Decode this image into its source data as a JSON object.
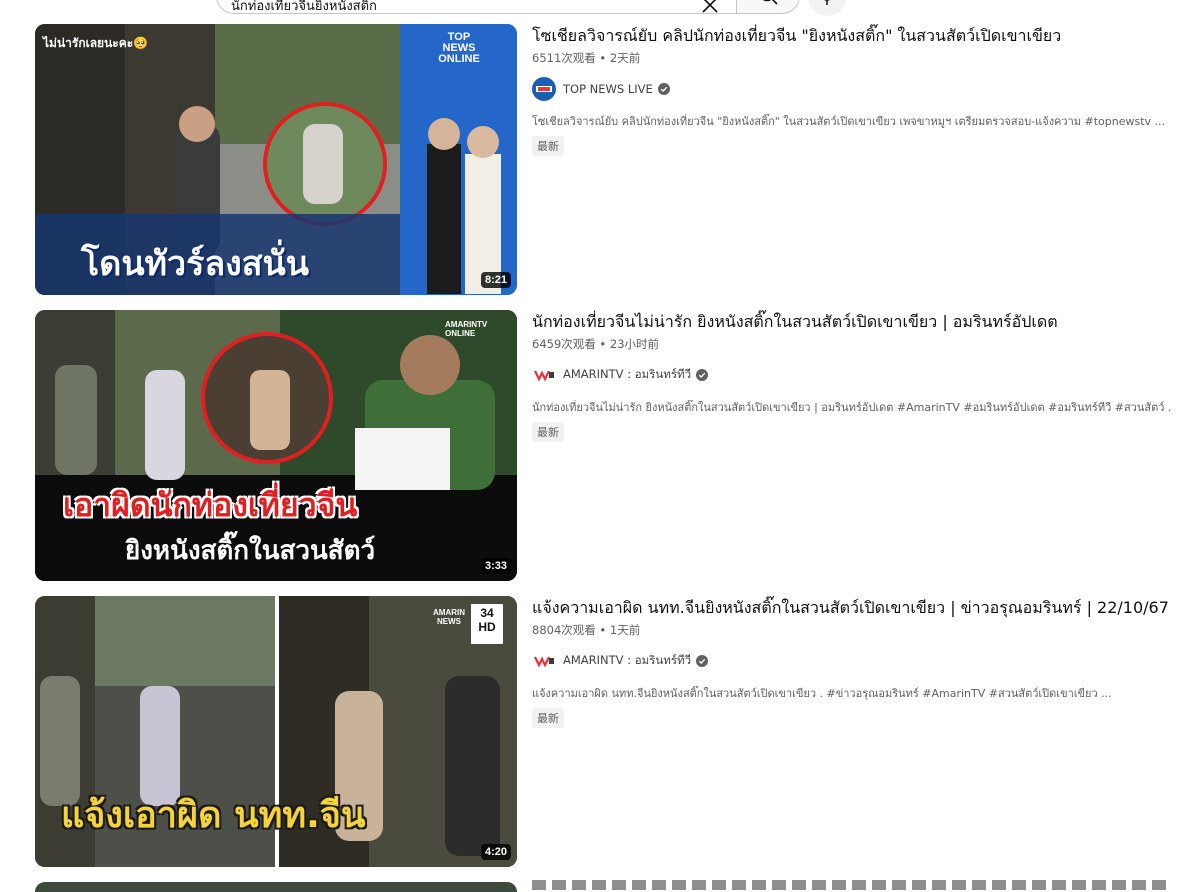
{
  "search": {
    "query": "นักท่องเที่ยวจีนยิงหนังสติ๊ก",
    "clear_icon": "close-icon",
    "search_icon": "search-icon",
    "mic_icon": "mic-icon"
  },
  "results": [
    {
      "title": "โซเชียลวิจารณ์ยับ คลิปนักท่องเที่ยวจีน \"ยิงหนังสติ๊ก\" ในสวนสัตว์เปิดเขาเขียว",
      "views": "6511次观看",
      "age": "2天前",
      "channel": "TOP NEWS LIVE",
      "verified": true,
      "description": "โซเชียลวิจารณ์ยับ คลิปนักท่องเที่ยวจีน \"ยิงหนังสติ๊ก\" ในสวนสัตว์เปิดเขาเขียว เพจขาหมูฯ เตรียมตรวจสอบ-แจ้งความ #topnewstv ...",
      "badge": "最新",
      "duration": "8:21",
      "thumb_caption": "โดนทัวร์ลงสนั่น",
      "thumb_top_text": "ไม่น่ารักเลยนะคะ🥺",
      "logo_text": "TOP NEWS ONLINE",
      "avatar_color": "#1b5fb5"
    },
    {
      "title": "นักท่องเที่ยวจีนไม่น่ารัก ยิงหนังสติ๊กในสวนสัตว์เปิดเขาเขียว | อมรินทร์อัปเดต",
      "views": "6459次观看",
      "age": "23小时前",
      "channel": "AMARINTV : อมรินทร์ทีวี",
      "verified": true,
      "description": "นักท่องเที่ยวจีนไม่น่ารัก ยิงหนังสติ๊กในสวนสัตว์เปิดเขาเขียว | อมรินทร์อัปเดต #AmarinTV #อมรินทร์อัปเดต #อมรินทร์ทีวี #สวนสัตว์ ...",
      "badge": "最新",
      "duration": "3:33",
      "thumb_caption": "เอาผิดนักท่องเที่ยวจีน",
      "thumb_caption2": "ยิงหนังสติ๊กในสวนสัตว์",
      "logo_text": "AMARINTV ONLINE",
      "avatar_color": "#e8303c"
    },
    {
      "title": "แจ้งความเอาผิด นทท.จีนยิงหนังสติ๊กในสวนสัตว์เปิดเขาเขียว | ข่าวอรุณอมรินทร์ | 22/10/67",
      "views": "8804次观看",
      "age": "1天前",
      "channel": "AMARINTV : อมรินทร์ทีวี",
      "verified": true,
      "description": "แจ้งความเอาผิด นทท.จีนยิงหนังสติ๊กในสวนสัตว์เปิดเขาเขียว . #ข่าวอรุณอมรินทร์ #AmarinTV #สวนสัตว์เปิดเขาเขียว ...",
      "badge": "最新",
      "duration": "4:20",
      "thumb_caption": "แจ้งเอาผิด นทท.จีน",
      "logo_text": "AMARIN NEWS",
      "channel_number": "34 HD",
      "avatar_color": "#e8303c"
    }
  ]
}
